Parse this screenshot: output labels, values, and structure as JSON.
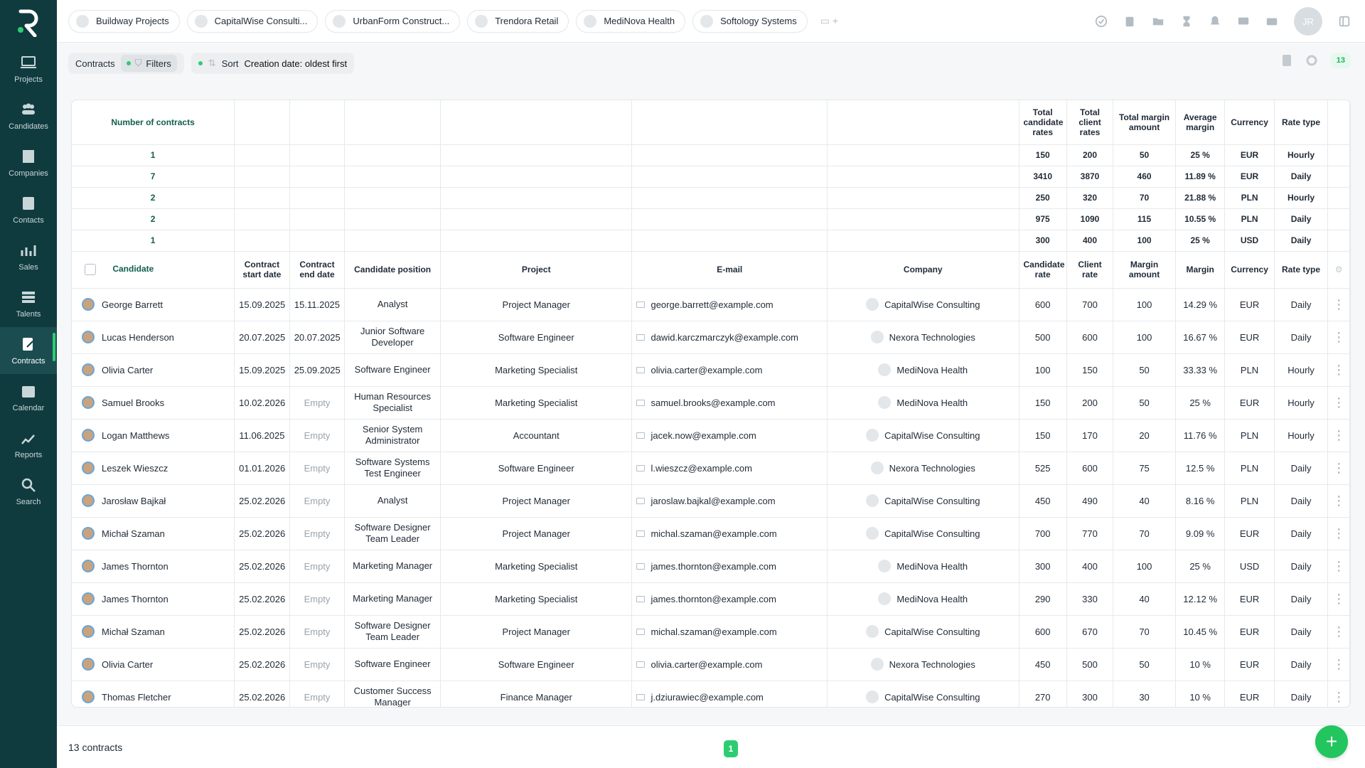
{
  "colors": {
    "sidebar": "#0f3b3f",
    "accent": "#22c55e",
    "green_text": "#0f5e4e"
  },
  "sidebar": {
    "items": [
      {
        "label": "Projects",
        "icon": "laptop-icon"
      },
      {
        "label": "Candidates",
        "icon": "people-icon"
      },
      {
        "label": "Companies",
        "icon": "building-icon"
      },
      {
        "label": "Contacts",
        "icon": "contact-card-icon"
      },
      {
        "label": "Sales",
        "icon": "sales-chart-icon"
      },
      {
        "label": "Talents",
        "icon": "list-icon"
      },
      {
        "label": "Contracts",
        "icon": "contract-icon"
      },
      {
        "label": "Calendar",
        "icon": "calendar-icon"
      },
      {
        "label": "Reports",
        "icon": "reports-icon"
      },
      {
        "label": "Search",
        "icon": "search-icon"
      }
    ]
  },
  "project_tabs": [
    "Buildway Projects",
    "CapitalWise Consulti...",
    "UrbanForm Construct...",
    "Trendora Retail",
    "MediNova Health",
    "Softology Systems"
  ],
  "user": {
    "initials": "JR"
  },
  "toolbar": {
    "contracts_label": "Contracts",
    "filters_label": "Filters",
    "sort_label": "Sort",
    "sort_value": "Creation date: oldest first",
    "count": "13"
  },
  "summary": {
    "header": {
      "number": "Number of contracts",
      "total_candidate": "Total candidate rates",
      "total_client": "Total client rates",
      "total_margin": "Total margin amount",
      "avg_margin": "Average margin",
      "currency": "Currency",
      "rate_type": "Rate type"
    },
    "rows": [
      {
        "count": "1",
        "cand": "150",
        "client": "200",
        "margin": "50",
        "avg": "25 %",
        "currency": "EUR",
        "rate": "Hourly"
      },
      {
        "count": "7",
        "cand": "3410",
        "client": "3870",
        "margin": "460",
        "avg": "11.89 %",
        "currency": "EUR",
        "rate": "Daily"
      },
      {
        "count": "2",
        "cand": "250",
        "client": "320",
        "margin": "70",
        "avg": "21.88 %",
        "currency": "PLN",
        "rate": "Hourly"
      },
      {
        "count": "2",
        "cand": "975",
        "client": "1090",
        "margin": "115",
        "avg": "10.55 %",
        "currency": "PLN",
        "rate": "Daily"
      },
      {
        "count": "1",
        "cand": "300",
        "client": "400",
        "margin": "100",
        "avg": "25 %",
        "currency": "USD",
        "rate": "Daily"
      }
    ]
  },
  "columns": {
    "candidate": "Candidate",
    "start": "Contract start date",
    "end": "Contract end date",
    "position": "Candidate position",
    "project": "Project",
    "email": "E-mail",
    "company": "Company",
    "cand_rate": "Candidate rate",
    "client_rate": "Client rate",
    "margin_amount": "Margin amount",
    "margin": "Margin",
    "currency": "Currency",
    "rate_type": "Rate type"
  },
  "rows": [
    {
      "name": "George Barrett",
      "start": "15.09.2025",
      "end": "15.11.2025",
      "position": "Analyst",
      "project": "Project Manager",
      "email": "george.barrett@example.com",
      "company": "CapitalWise Consulting",
      "cr": "600",
      "cl": "700",
      "ma": "100",
      "m": "14.29 %",
      "cur": "EUR",
      "rt": "Daily"
    },
    {
      "name": "Lucas Henderson",
      "start": "20.07.2025",
      "end": "20.07.2025",
      "position": "Junior Software Developer",
      "project": "Software Engineer",
      "email": "dawid.karczmarczyk@example.com",
      "company": "Nexora Technologies",
      "cr": "500",
      "cl": "600",
      "ma": "100",
      "m": "16.67 %",
      "cur": "EUR",
      "rt": "Daily"
    },
    {
      "name": "Olivia Carter",
      "start": "15.09.2025",
      "end": "25.09.2025",
      "position": "Software Engineer",
      "project": "Marketing Specialist",
      "email": "olivia.carter@example.com",
      "company": "MediNova Health",
      "cr": "100",
      "cl": "150",
      "ma": "50",
      "m": "33.33 %",
      "cur": "PLN",
      "rt": "Hourly"
    },
    {
      "name": "Samuel Brooks",
      "start": "10.02.2026",
      "end": "Empty",
      "position": "Human Resources Specialist",
      "project": "Marketing Specialist",
      "email": "samuel.brooks@example.com",
      "company": "MediNova Health",
      "cr": "150",
      "cl": "200",
      "ma": "50",
      "m": "25 %",
      "cur": "EUR",
      "rt": "Hourly"
    },
    {
      "name": "Logan Matthews",
      "start": "11.06.2025",
      "end": "Empty",
      "position": "Senior System Administrator",
      "project": "Accountant",
      "email": "jacek.now@example.com",
      "company": "CapitalWise Consulting",
      "cr": "150",
      "cl": "170",
      "ma": "20",
      "m": "11.76 %",
      "cur": "PLN",
      "rt": "Hourly"
    },
    {
      "name": "Leszek Wieszcz",
      "start": "01.01.2026",
      "end": "Empty",
      "position": "Software Systems Test Engineer",
      "project": "Software Engineer",
      "email": "l.wieszcz@example.com",
      "company": "Nexora Technologies",
      "cr": "525",
      "cl": "600",
      "ma": "75",
      "m": "12.5 %",
      "cur": "PLN",
      "rt": "Daily"
    },
    {
      "name": "Jarosław Bajkał",
      "start": "25.02.2026",
      "end": "Empty",
      "position": "Analyst",
      "project": "Project Manager",
      "email": "jaroslaw.bajkal@example.com",
      "company": "CapitalWise Consulting",
      "cr": "450",
      "cl": "490",
      "ma": "40",
      "m": "8.16 %",
      "cur": "PLN",
      "rt": "Daily"
    },
    {
      "name": "Michał Szaman",
      "start": "25.02.2026",
      "end": "Empty",
      "position": "Software Designer Team Leader",
      "project": "Project Manager",
      "email": "michal.szaman@example.com",
      "company": "CapitalWise Consulting",
      "cr": "700",
      "cl": "770",
      "ma": "70",
      "m": "9.09 %",
      "cur": "EUR",
      "rt": "Daily"
    },
    {
      "name": "James Thornton",
      "start": "25.02.2026",
      "end": "Empty",
      "position": "Marketing Manager",
      "project": "Marketing Specialist",
      "email": "james.thornton@example.com",
      "company": "MediNova Health",
      "cr": "300",
      "cl": "400",
      "ma": "100",
      "m": "25 %",
      "cur": "USD",
      "rt": "Daily"
    },
    {
      "name": "James Thornton",
      "start": "25.02.2026",
      "end": "Empty",
      "position": "Marketing Manager",
      "project": "Marketing Specialist",
      "email": "james.thornton@example.com",
      "company": "MediNova Health",
      "cr": "290",
      "cl": "330",
      "ma": "40",
      "m": "12.12 %",
      "cur": "EUR",
      "rt": "Daily"
    },
    {
      "name": "Michał Szaman",
      "start": "25.02.2026",
      "end": "Empty",
      "position": "Software Designer Team Leader",
      "project": "Project Manager",
      "email": "michal.szaman@example.com",
      "company": "CapitalWise Consulting",
      "cr": "600",
      "cl": "670",
      "ma": "70",
      "m": "10.45 %",
      "cur": "EUR",
      "rt": "Daily"
    },
    {
      "name": "Olivia Carter",
      "start": "25.02.2026",
      "end": "Empty",
      "position": "Software Engineer",
      "project": "Software Engineer",
      "email": "olivia.carter@example.com",
      "company": "Nexora Technologies",
      "cr": "450",
      "cl": "500",
      "ma": "50",
      "m": "10 %",
      "cur": "EUR",
      "rt": "Daily"
    },
    {
      "name": "Thomas Fletcher",
      "start": "25.02.2026",
      "end": "Empty",
      "position": "Customer Success Manager",
      "project": "Finance Manager",
      "email": "j.dziurawiec@example.com",
      "company": "CapitalWise Consulting",
      "cr": "270",
      "cl": "300",
      "ma": "30",
      "m": "10 %",
      "cur": "EUR",
      "rt": "Daily"
    }
  ],
  "footer": {
    "total": "13 contracts",
    "page": "1"
  },
  "fab": {
    "label": "+"
  }
}
